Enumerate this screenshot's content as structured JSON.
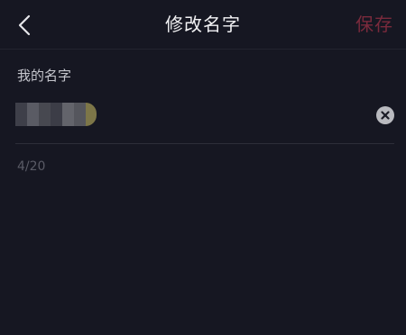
{
  "header": {
    "title": "修改名字",
    "save_label": "保存",
    "back_icon": "chevron-left-icon"
  },
  "form": {
    "label": "我的名字",
    "name_value": "",
    "clear_icon": "clear-circle-icon",
    "counter": "4/20"
  },
  "colors": {
    "background": "#161722",
    "save_text": "#7a2a3c",
    "title_text": "#f2f2f4",
    "label_text": "#c4c5cc",
    "counter_text": "#5a5b66"
  }
}
